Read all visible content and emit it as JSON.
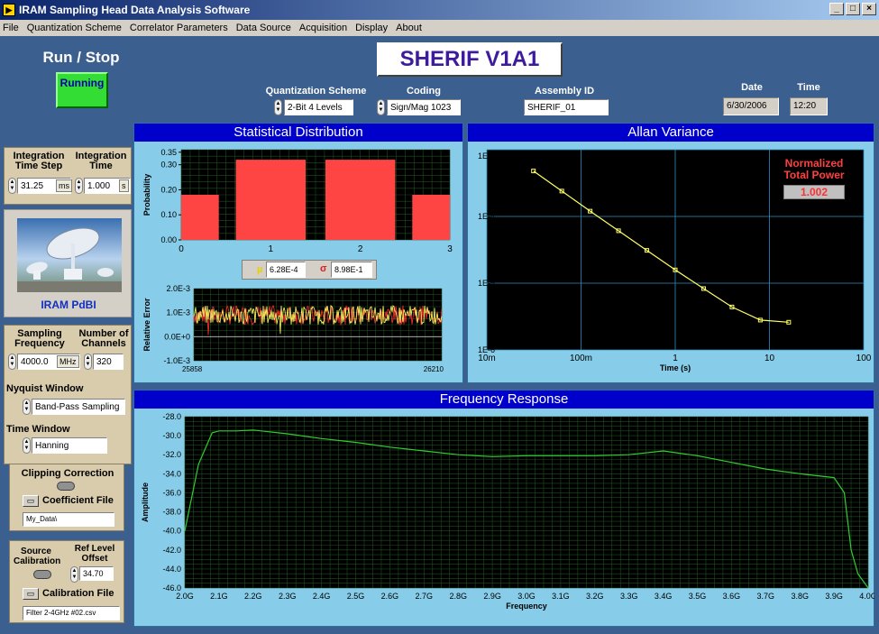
{
  "window": {
    "title": "IRAM Sampling Head Data Analysis Software",
    "min": "_",
    "max": "□",
    "close": "×"
  },
  "menu": [
    "File",
    "Quantization Scheme",
    "Correlator Parameters",
    "Data Source",
    "Acquisition",
    "Display",
    "About"
  ],
  "run": {
    "label": "Run / Stop",
    "state": "Running"
  },
  "header": {
    "title": "SHERIF V1A1"
  },
  "quant": {
    "label": "Quantization Scheme",
    "value": "2-Bit  4 Levels"
  },
  "coding": {
    "label": "Coding",
    "value": "Sign/Mag 1023"
  },
  "assembly": {
    "label": "Assembly ID",
    "value": "SHERIF_01"
  },
  "date": {
    "label": "Date",
    "value": "6/30/2006"
  },
  "time": {
    "label": "Time",
    "value": "12:20"
  },
  "integration": {
    "step_label": "Integration Time Step",
    "time_label": "Integration Time",
    "step_value": "31.25",
    "step_unit": "ms",
    "time_value": "1.000",
    "time_unit": "s"
  },
  "logo_caption": "IRAM PdBI",
  "sampling": {
    "freq_label": "Sampling Frequency",
    "chan_label": "Number of Channels",
    "freq_value": "4000.0",
    "freq_unit": "MHz",
    "chan_value": "320"
  },
  "nyquist": {
    "label": "Nyquist Window",
    "value": "Band-Pass Sampling"
  },
  "timewin": {
    "label": "Time Window",
    "value": "Hanning"
  },
  "clipping": {
    "label": "Clipping Correction",
    "file_label": "Coefficient File",
    "path": "My_Data\\"
  },
  "source": {
    "cal_label": "Source Calibration",
    "ref_label": "Ref Level Offset",
    "ref_value": "34.70",
    "file_label": "Calibration File",
    "path": "Filter 2-4GHz #02.csv"
  },
  "stat": {
    "title": "Statistical Distribution",
    "mu_symbol": "µ",
    "mu_value": "6.28E-4",
    "sigma_symbol": "σ",
    "sigma_value": "8.98E-1"
  },
  "allan": {
    "title": "Allan Variance",
    "ntp_label1": "Normalized",
    "ntp_label2": "Total Power",
    "ntp_value": "1.002"
  },
  "freq": {
    "title": "Frequency Response"
  },
  "colors": {
    "accent": "#0000cc",
    "plotbg": "#000000",
    "bars": "#ff4444",
    "trace": "#ffff66",
    "freqline": "#33cc33",
    "running": "#33dd33"
  },
  "chart_data": [
    {
      "type": "bar",
      "title": "Statistical Distribution",
      "ylabel": "Probability",
      "categories": [
        "0",
        "1",
        "2",
        "3"
      ],
      "x_ticks": [
        "0",
        "1",
        "2",
        "3"
      ],
      "y_ticks": [
        "0.00",
        "0.10",
        "0.20",
        "0.30",
        "0.35"
      ],
      "ylim": [
        0,
        0.36
      ],
      "values": [
        0.18,
        0.32,
        0.32,
        0.18
      ]
    },
    {
      "type": "line",
      "ylabel": "Relative Error",
      "x_ticks": [
        "25858",
        "26210"
      ],
      "y_ticks": [
        "-1.0E-3",
        "0.0E+0",
        "1.0E-3",
        "2.0E-3"
      ],
      "ylim": [
        -0.001,
        0.002
      ],
      "series": [
        {
          "mean": 0.0009,
          "spread": 0.0004
        }
      ]
    },
    {
      "type": "line",
      "title": "Allan Variance",
      "xlabel": "Time (s)",
      "x_ticks": [
        "10m",
        "100m",
        "1",
        "10",
        "100"
      ],
      "y_ticks": [
        "1E-6",
        "1E-5",
        "1E-4",
        "1E-3"
      ],
      "xlog": true,
      "ylog": true,
      "x": [
        0.03125,
        0.0625,
        0.125,
        0.25,
        0.5,
        1,
        2,
        4,
        8,
        16
      ],
      "y": [
        0.00048,
        0.00024,
        0.00012,
        6.1e-05,
        3.1e-05,
        1.58e-05,
        8.3e-06,
        4.4e-06,
        2.8e-06,
        2.6e-06
      ]
    },
    {
      "type": "line",
      "title": "Frequency Response",
      "xlabel": "Frequency",
      "ylabel": "Amplitude",
      "x_ticks": [
        "2.0G",
        "2.1G",
        "2.2G",
        "2.3G",
        "2.4G",
        "2.5G",
        "2.6G",
        "2.7G",
        "2.8G",
        "2.9G",
        "3.0G",
        "3.1G",
        "3.2G",
        "3.3G",
        "3.4G",
        "3.5G",
        "3.6G",
        "3.7G",
        "3.8G",
        "3.9G",
        "4.0G"
      ],
      "y_ticks": [
        "-28.0",
        "-30.0",
        "-32.0",
        "-34.0",
        "-36.0",
        "-38.0",
        "-40.0",
        "-42.0",
        "-44.0",
        "-46.0"
      ],
      "ylim": [
        -46,
        -28
      ],
      "x": [
        2.0,
        2.04,
        2.08,
        2.1,
        2.15,
        2.2,
        2.3,
        2.4,
        2.5,
        2.6,
        2.7,
        2.8,
        2.9,
        3.0,
        3.1,
        3.2,
        3.3,
        3.4,
        3.5,
        3.6,
        3.7,
        3.8,
        3.9,
        3.93,
        3.95,
        3.97,
        4.0
      ],
      "y": [
        -40,
        -33,
        -29.7,
        -29.5,
        -29.5,
        -29.4,
        -29.8,
        -30.3,
        -30.7,
        -31.2,
        -31.6,
        -32,
        -32.2,
        -32.1,
        -32.1,
        -32.1,
        -32.0,
        -31.6,
        -32.1,
        -32.8,
        -33.5,
        -34.0,
        -34.4,
        -36,
        -42,
        -44.5,
        -46
      ]
    }
  ]
}
